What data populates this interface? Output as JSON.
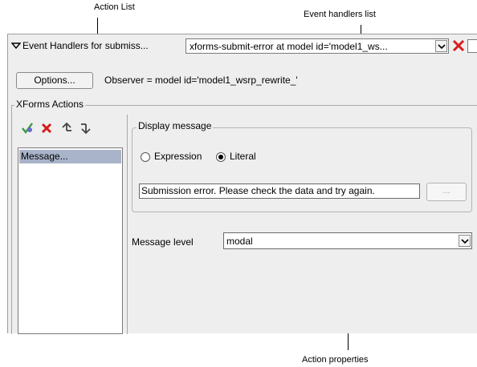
{
  "callouts": {
    "action_list": "Action List",
    "event_handlers_list": "Event handlers list",
    "action_properties": "Action properties"
  },
  "header": {
    "title": "Event Handlers for submiss...",
    "handler_selected": "xforms-submit-error at model id='model1_ws..."
  },
  "options_button": "Options...",
  "observer": "Observer = model id='model1_wsrp_rewrite_'",
  "actions_section": {
    "legend": "XForms Actions",
    "toolbar_icons": [
      "add-action-icon",
      "delete-icon",
      "move-up-icon",
      "move-down-icon"
    ],
    "items": [
      "Message..."
    ]
  },
  "display_message": {
    "legend": "Display message",
    "radio_expression": "Expression",
    "radio_literal": "Literal",
    "selected_radio": "Literal",
    "message_text": "Submission error. Please check the data and try again.",
    "ellipsis_button": "..."
  },
  "message_level": {
    "label": "Message level",
    "value": "modal"
  },
  "colors": {
    "panel_bg": "#eeeeee",
    "selection_bg": "#a9b3c9",
    "delete_red": "#d91a1a",
    "add_green": "#3f9a3f"
  }
}
